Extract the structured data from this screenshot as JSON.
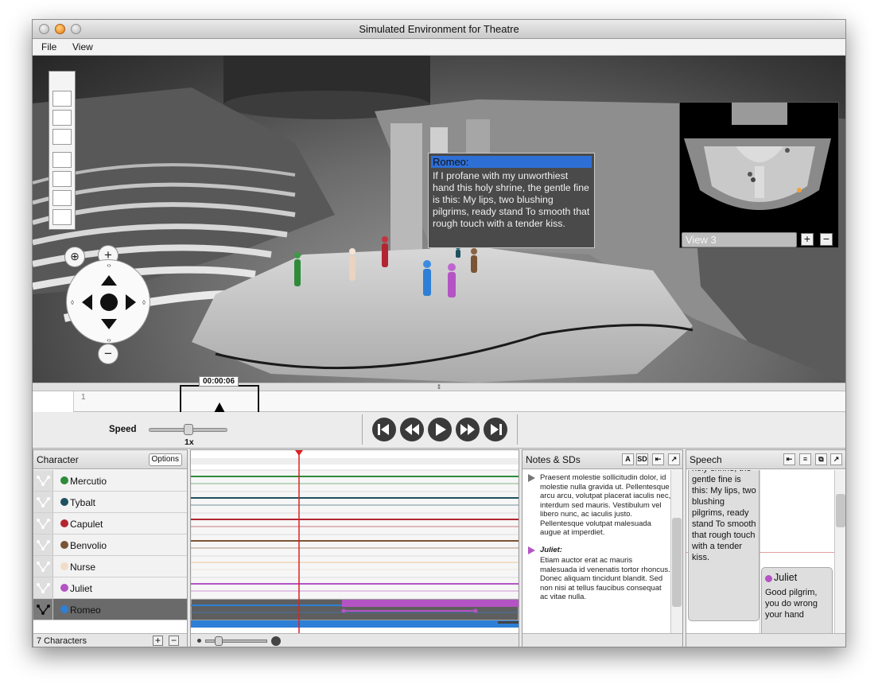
{
  "window": {
    "title": "Simulated Environment for Theatre"
  },
  "menu": {
    "file": "File",
    "view": "View"
  },
  "tooltip": {
    "speaker": "Romeo:",
    "text": "If I profane with my unworthiest hand this holy shrine, the gentle fine is this: My lips, two blushing pilgrims, ready stand To smooth that rough touch with a tender kiss."
  },
  "minimap": {
    "view_label": "View 3",
    "add": "+",
    "remove": "−"
  },
  "timeline": {
    "time": "00:00:06",
    "marker": "1"
  },
  "transport": {
    "speed_label": "Speed",
    "speed_value": "1x",
    "buttons": [
      "skip-back-icon",
      "rewind-icon",
      "play-icon",
      "fast-forward-icon",
      "skip-forward-icon"
    ]
  },
  "characters": {
    "header": "Character",
    "options_label": "Options",
    "footer": "7 Characters",
    "list": [
      {
        "name": "Mercutio",
        "color": "#2e8b3a"
      },
      {
        "name": "Tybalt",
        "color": "#1e5160"
      },
      {
        "name": "Capulet",
        "color": "#b32531"
      },
      {
        "name": "Benvolio",
        "color": "#7a5535"
      },
      {
        "name": "Nurse",
        "color": "#f2dcc8"
      },
      {
        "name": "Juliet",
        "color": "#b454c4"
      },
      {
        "name": "Romeo",
        "color": "#2e7fd6"
      }
    ]
  },
  "notes": {
    "header": "Notes & SDs",
    "icons": {
      "a": "A",
      "sd": "SD"
    },
    "entries": [
      {
        "title": "",
        "text": "Praesent molestie sollicitudin dolor, id molestie nulla gravida ut. Pellentesque arcu arcu, volutpat placerat iaculis nec, interdum sed mauris. Vestibulum vel libero nunc, ac iaculis justo. Pellentesque volutpat malesuada augue at imperdiet."
      },
      {
        "title": "Juliet:",
        "text": "Etiam auctor erat ac mauris malesuada id venenatis tortor rhoncus. Donec aliquam tincidunt blandit. Sed non nisi at tellus faucibus consequat ac vitae nulla."
      }
    ]
  },
  "speech": {
    "header": "Speech",
    "romeo_text": "holy shrine, the gentle fine is this: My lips, two blushing pilgrims, ready stand To smooth that rough touch with a tender kiss.",
    "juliet_name": "Juliet",
    "juliet_text": "Good pilgrim, you do wrong your hand"
  }
}
